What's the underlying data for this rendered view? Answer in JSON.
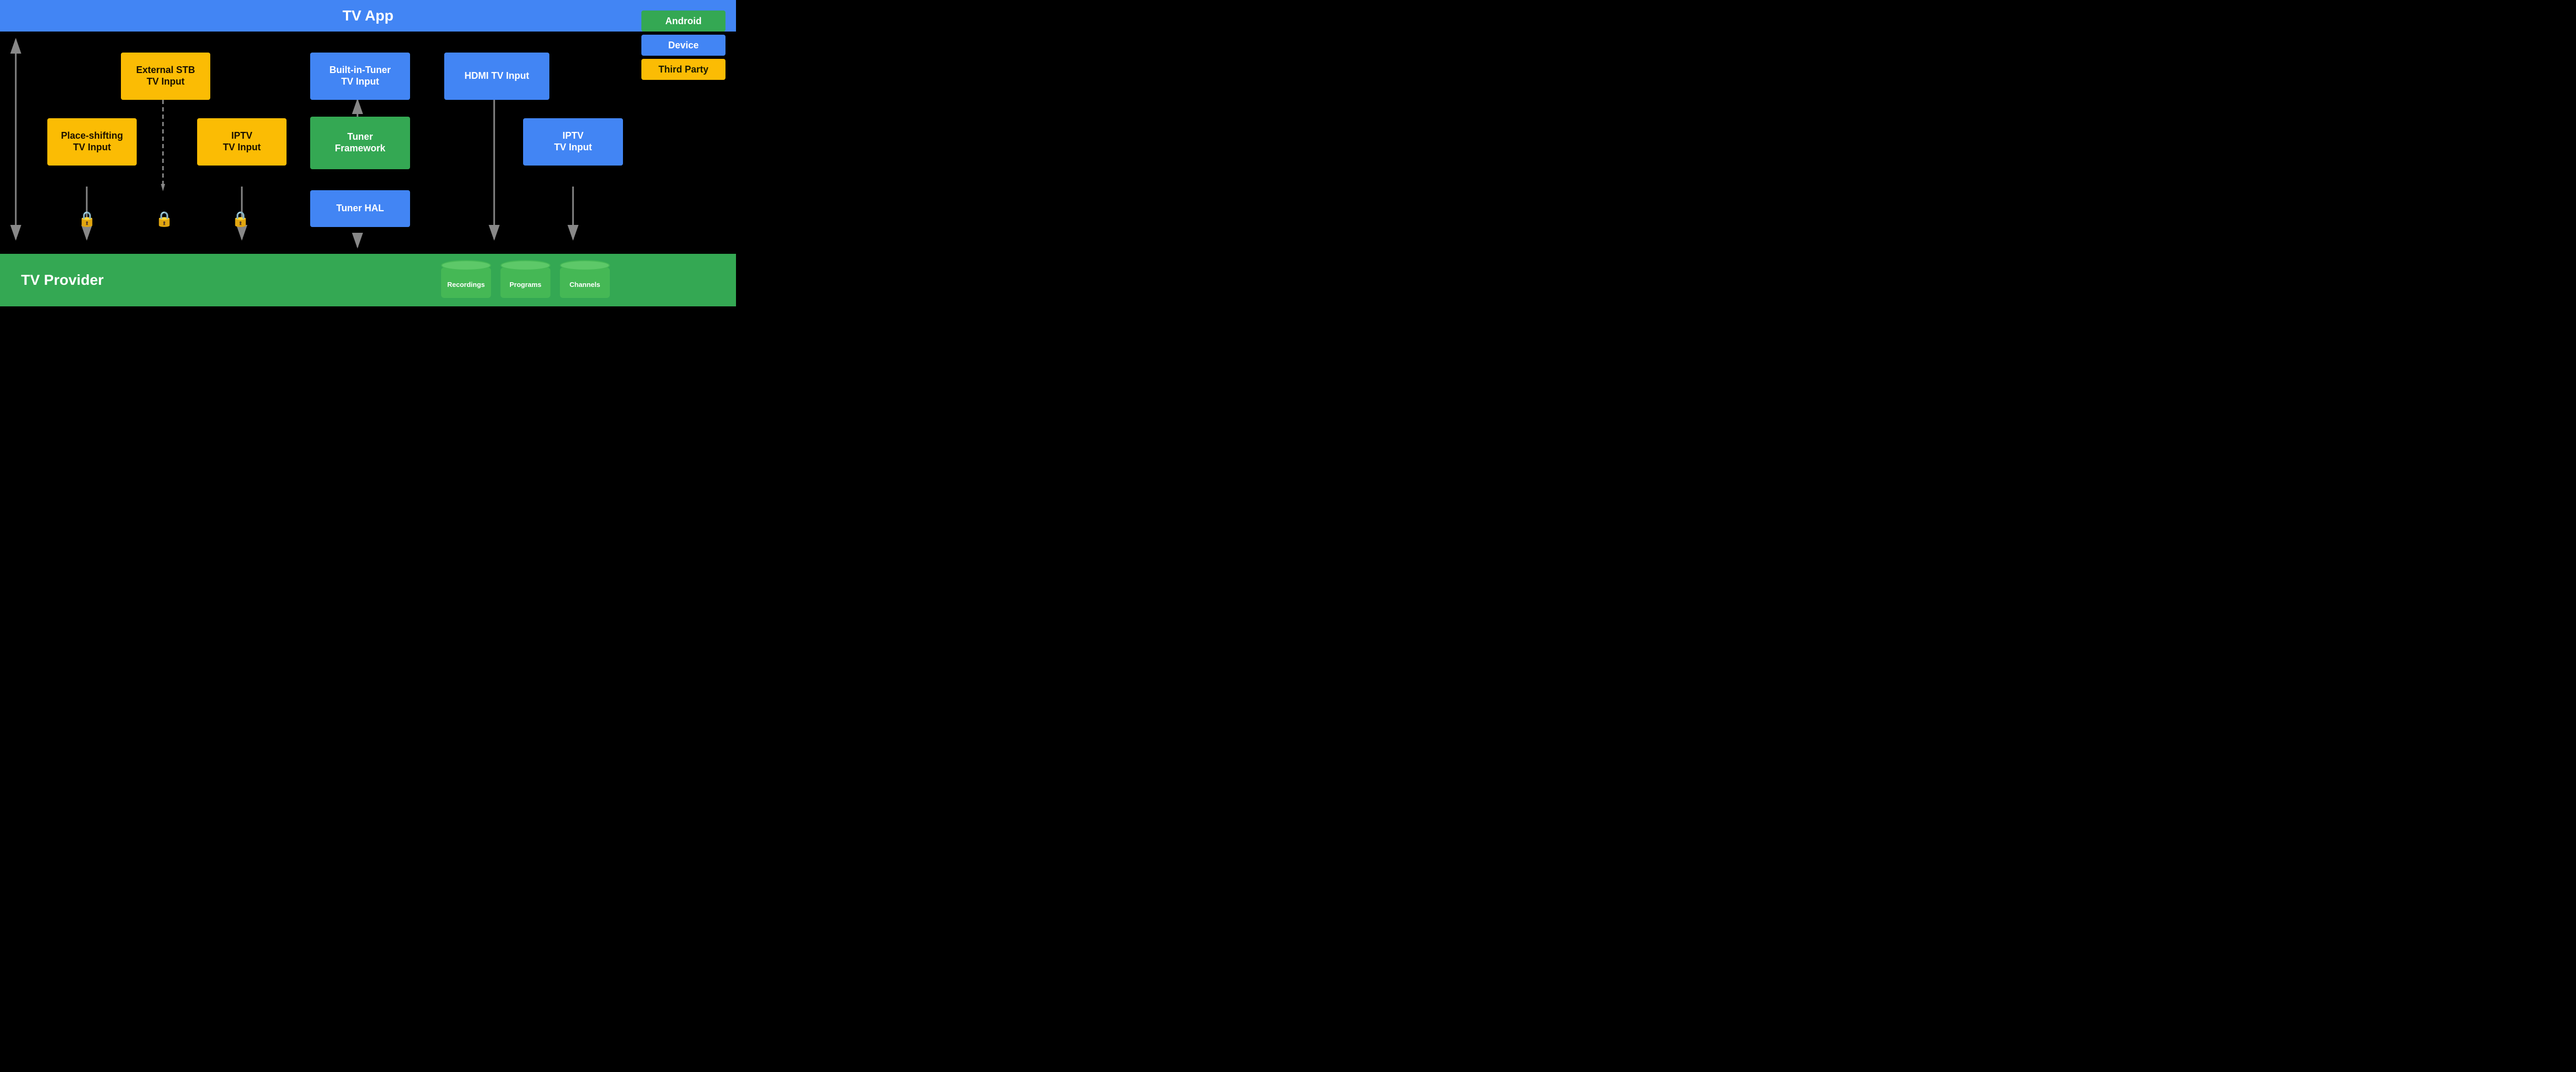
{
  "header": {
    "title": "TV App",
    "bg": "#4285F4"
  },
  "footer": {
    "title": "TV Provider",
    "bg": "#34A853"
  },
  "legend": {
    "items": [
      {
        "label": "Android",
        "color": "#34A853",
        "text_color": "white"
      },
      {
        "label": "Device",
        "color": "#4285F4",
        "text_color": "white"
      },
      {
        "label": "Third Party",
        "color": "#FBBC04",
        "text_color": "#1a1000"
      }
    ]
  },
  "boxes": {
    "place_shifting": "Place-shifting\nTV Input",
    "external_stb": "External STB\nTV Input",
    "iptv_left": "IPTV\nTV Input",
    "built_in_tuner": "Built-in-Tuner\nTV Input",
    "tuner_framework": "Tuner\nFramework",
    "tuner_hal": "Tuner HAL",
    "hdmi_tv_input": "HDMI TV Input",
    "iptv_right": "IPTV\nTV Input"
  },
  "cylinders": [
    {
      "label": "Recordings"
    },
    {
      "label": "Programs"
    },
    {
      "label": "Channels"
    }
  ]
}
